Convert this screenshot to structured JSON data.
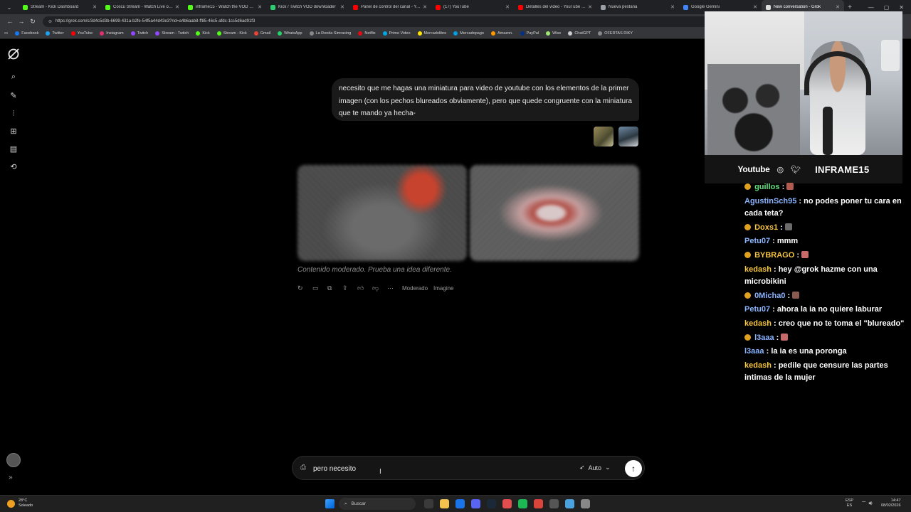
{
  "browser": {
    "tabs": [
      {
        "title": "Stream - Kick Dashboard",
        "color": "#53fc18",
        "active": false
      },
      {
        "title": "Coscu Stream - Watch Live on Ki",
        "color": "#53fc18",
        "active": false
      },
      {
        "title": "inframe15 - Watch the VOD on K",
        "color": "#53fc18",
        "active": false
      },
      {
        "title": "Kick / Twitch VOD downloader",
        "color": "#2ecc71",
        "active": false
      },
      {
        "title": "Panel de control del canal - YouT",
        "color": "#ff0000",
        "active": false
      },
      {
        "title": "(17) YouTube",
        "color": "#ff0000",
        "active": false
      },
      {
        "title": "Detalles del video - YouTube Stu",
        "color": "#ff0000",
        "active": false
      },
      {
        "title": "Nueva pestaña",
        "color": "#9aa0a6",
        "active": false
      },
      {
        "title": "Google Gemini",
        "color": "#4285f4",
        "active": false
      },
      {
        "title": "New conversation - Grok",
        "color": "#dddddd",
        "active": true
      }
    ],
    "url": "https://grok.com/c/3d4c5d3b-6699-431a-b2fe-54f5a44d43e3?rid=a4b6aab8-ff85-46c5-afdc-1cc5d6ad91f3",
    "bookmarks": [
      {
        "label": "Facebook",
        "color": "#1877f2"
      },
      {
        "label": "Twitter",
        "color": "#1da1f2"
      },
      {
        "label": "YouTube",
        "color": "#ff0000"
      },
      {
        "label": "Instagram",
        "color": "#e1306c"
      },
      {
        "label": "Twitch",
        "color": "#9146ff"
      },
      {
        "label": "Stream - Twitch",
        "color": "#9146ff"
      },
      {
        "label": "Kick",
        "color": "#53fc18"
      },
      {
        "label": "Stream - Kick",
        "color": "#53fc18"
      },
      {
        "label": "Gmail",
        "color": "#ea4335"
      },
      {
        "label": "WhatsApp",
        "color": "#25d366"
      },
      {
        "label": "La Ronda Simracing",
        "color": "#888888"
      },
      {
        "label": "Netflix",
        "color": "#e50914"
      },
      {
        "label": "Prime Video",
        "color": "#00a8e1"
      },
      {
        "label": "Mercadolibre",
        "color": "#ffe600"
      },
      {
        "label": "Mercadopago",
        "color": "#009ee3"
      },
      {
        "label": "Amazon.",
        "color": "#ff9900"
      },
      {
        "label": "PayPal",
        "color": "#003087"
      },
      {
        "label": "Wise",
        "color": "#9fe870"
      },
      {
        "label": "ChatGPT",
        "color": "#cccccc"
      },
      {
        "label": "OFERTAS RIKY",
        "color": "#888888"
      }
    ]
  },
  "grok": {
    "user_message": "necesito que me hagas una miniatura para video de youtube con los elementos de la primer imagen (con los pechos blureados obviamente), pero que quede congruente con la miniatura que te mando ya hecha-",
    "moderated_notice": "Contenido moderado. Prueba una idea diferente.",
    "action_labels": [
      "Moderado",
      "Imagine"
    ],
    "composer_value": "pero necesito",
    "model_label": "Auto"
  },
  "stream": {
    "platform_label": "Youtube",
    "handle": "INFRAME15",
    "chat": [
      {
        "user": "guillos",
        "text": "",
        "color": "#5be37a",
        "emote": "#b55a4e"
      },
      {
        "user": "AgustinSch95",
        "text": "no podes poner tu cara en cada teta?",
        "color": "#8ab4ff",
        "emote": ""
      },
      {
        "user": "Doxs1",
        "text": "",
        "color": "#f5c542",
        "emote": "#6b6b6b"
      },
      {
        "user": "Petu07",
        "text": "mmm",
        "color": "#8ab4ff",
        "emote": ""
      },
      {
        "user": "BYBRAGO",
        "text": "",
        "color": "#f5c542",
        "emote": "#c76a6a"
      },
      {
        "user": "kedash",
        "text": "hey @grok hazme con una microbikini",
        "color": "#f5c542",
        "emote": ""
      },
      {
        "user": "0Micha0",
        "text": "",
        "color": "#8ab4ff",
        "emote": "#8a5a4e"
      },
      {
        "user": "Petu07",
        "text": "ahora la ia no quiere laburar",
        "color": "#8ab4ff",
        "emote": ""
      },
      {
        "user": "kedash",
        "text": "creo que no te toma el \"blureado\"",
        "color": "#f5c542",
        "emote": ""
      },
      {
        "user": "l3aaa",
        "text": "",
        "color": "#8ab4ff",
        "emote": "#c76a6a"
      },
      {
        "user": "l3aaa",
        "text": "la ia es una poronga",
        "color": "#8ab4ff",
        "emote": ""
      },
      {
        "user": "kedash",
        "text": "pedile que censure las partes intimas de la mujer",
        "color": "#f5c542",
        "emote": ""
      }
    ]
  },
  "taskbar": {
    "weather_temp": "28°C",
    "weather_desc": "Soleado",
    "search_label": "Buscar",
    "lang_top": "ESP",
    "lang_bottom": "ES",
    "time": "14:47",
    "date": "08/02/2026",
    "apps": [
      {
        "name": "task-view",
        "color": "#3a3a3a"
      },
      {
        "name": "file-explorer",
        "color": "#f2c14e"
      },
      {
        "name": "chrome",
        "color": "#1a73e8"
      },
      {
        "name": "discord",
        "color": "#5865f2"
      },
      {
        "name": "steam",
        "color": "#1b2838"
      },
      {
        "name": "capcut",
        "color": "#e44d4d"
      },
      {
        "name": "spotify",
        "color": "#1db954"
      },
      {
        "name": "obs",
        "color": "#d9453a"
      },
      {
        "name": "media-app",
        "color": "#555555"
      },
      {
        "name": "notepad",
        "color": "#4aa3df"
      },
      {
        "name": "obs-studio",
        "color": "#888888"
      }
    ]
  }
}
